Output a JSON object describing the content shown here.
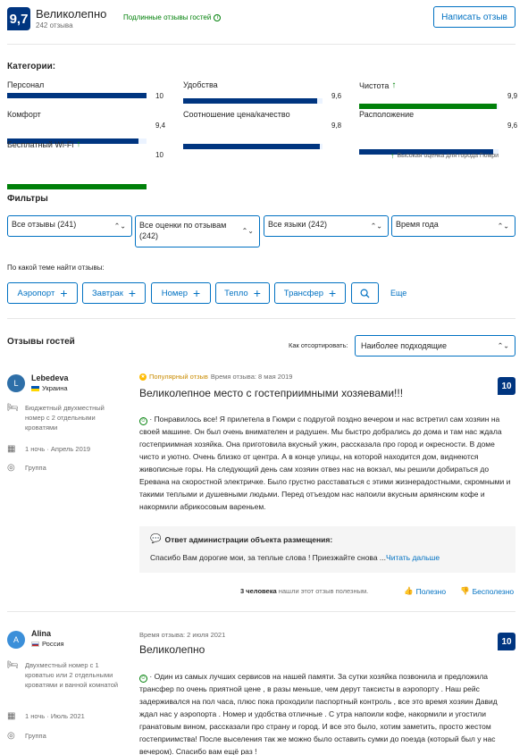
{
  "header": {
    "score": "9,7",
    "rating_word": "Великолепно",
    "review_count": "242 отзыва",
    "verified": "Подлинные отзывы гостей",
    "write_review": "Написать отзыв"
  },
  "categories": {
    "title": "Категории:",
    "items": [
      {
        "label": "Персонал",
        "score": "10",
        "value": 10,
        "high": false
      },
      {
        "label": "Удобства",
        "score": "9,6",
        "value": 9.6,
        "high": false
      },
      {
        "label": "Чистота",
        "score": "9,9",
        "value": 9.9,
        "high": true
      },
      {
        "label": "Комфорт",
        "score": "9,4",
        "value": 9.4,
        "high": false
      },
      {
        "label": "Соотношение цена/качество",
        "score": "9,8",
        "value": 9.8,
        "high": false
      },
      {
        "label": "Расположение",
        "score": "9,6",
        "value": 9.6,
        "high": false
      },
      {
        "label": "Бесплатный Wi-Fi",
        "score": "10",
        "value": 10,
        "high": true
      }
    ],
    "high_score_note": "Высокая оценка для города Гюмри",
    "colors": {
      "bar": "#003580",
      "high": "#008009",
      "track": "#ebf3ff"
    }
  },
  "filters": {
    "title": "Фильтры",
    "reviews_select": "Все отзывы (241)",
    "scores_select_1": "Все оценки по отзывам",
    "scores_select_2": "(242)",
    "languages_select": "Все языки (242)",
    "season_select": "Время года",
    "topics_label": "По какой теме найти отзывы:",
    "topics": [
      "Аэропорт",
      "Завтрак",
      "Номер",
      "Тепло",
      "Трансфер"
    ],
    "more": "Еще"
  },
  "reviews_section": {
    "title": "Отзывы гостей",
    "sort_label": "Как отсортировать:",
    "sort_value": "Наиболее подходящие"
  },
  "reviews": [
    {
      "avatar_letter": "L",
      "avatar_color": "#2e6fa8",
      "name": "Lebedeva",
      "country": "Украина",
      "room": "Бюджетный двухместный номер с 2 отдельными кроватями",
      "stay": "1 ночь · Апрель 2019",
      "group": "Группа",
      "popular": "Популярный отзыв",
      "date": "Время отзыва: 8 мая 2019",
      "title": "Великолепное место с гостеприимными хозяевами!!!",
      "score": "10",
      "text": "· Понравилось все! Я прилетела в Гюмри с подругой поздно вечером и нас встретил сам хозяин на своей машине. Он был очень внимателен и радушен. Мы быстро добрались до дома и там нас ждала гостеприимная хозяйка. Она приготовила вкусный ужин, рассказала про город и окресности. В доме чисто и уютно. Очень близко от центра. А в конце улицы, на которой находится дом, виднеются живописные горы. На следующий день сам хозяин отвез нас на вокзал, мы решили добираться до Еревана на скоростной электричке. Было грустно расставаться с этими жизнерадостными, скромными и такими теплыми и душевными людьми. Перед отъездом нас напоили вкусным армянским кофе и накормили абрикосовым вареньем.",
      "reply_title": "Ответ администрации объекта размещения:",
      "reply_text": "Спасибо Вам дорогие мои, за теплые слова ! Приезжайте снова ...",
      "read_more": "Читать дальше",
      "helpful_count": "3 человека",
      "helpful_text": "нашли этот отзыв полезным.",
      "helpful_yes": "Полезно",
      "helpful_no": "Бесполезно"
    },
    {
      "avatar_letter": "A",
      "avatar_color": "#3b8fd9",
      "name": "Alina",
      "country": "Россия",
      "room": "Двухместный номер с 1 кроватью или 2 отдельными кроватями и ванной комнатой",
      "stay": "1 ночь · Июль 2021",
      "group": "Группа",
      "date": "Время отзыва: 2 июля 2021",
      "title": "Великолепно",
      "score": "10",
      "text": "· Один из самых лучших сервисов на нашей памяти. За сутки хозяйка позвонила и предложила трансфер по очень приятной цене , в разы меньше, чем дерут таксисты в аэропорту . Наш рейс задерживался на пол часа, плюс пока проходили паспортный контроль , все это время хозяин Давид ждал нас у аэропорта . Номер и удобства отличные . С утра напоили кофе, накормили и угостили гранатовым вином, рассказали про страну и город. И все это было, хотим заметить, просто жестом гостеприимства! После выселения так же можно было оставить сумки до поезда (который был у нас вечером). Спасибо вам ещё раз !"
    }
  ]
}
